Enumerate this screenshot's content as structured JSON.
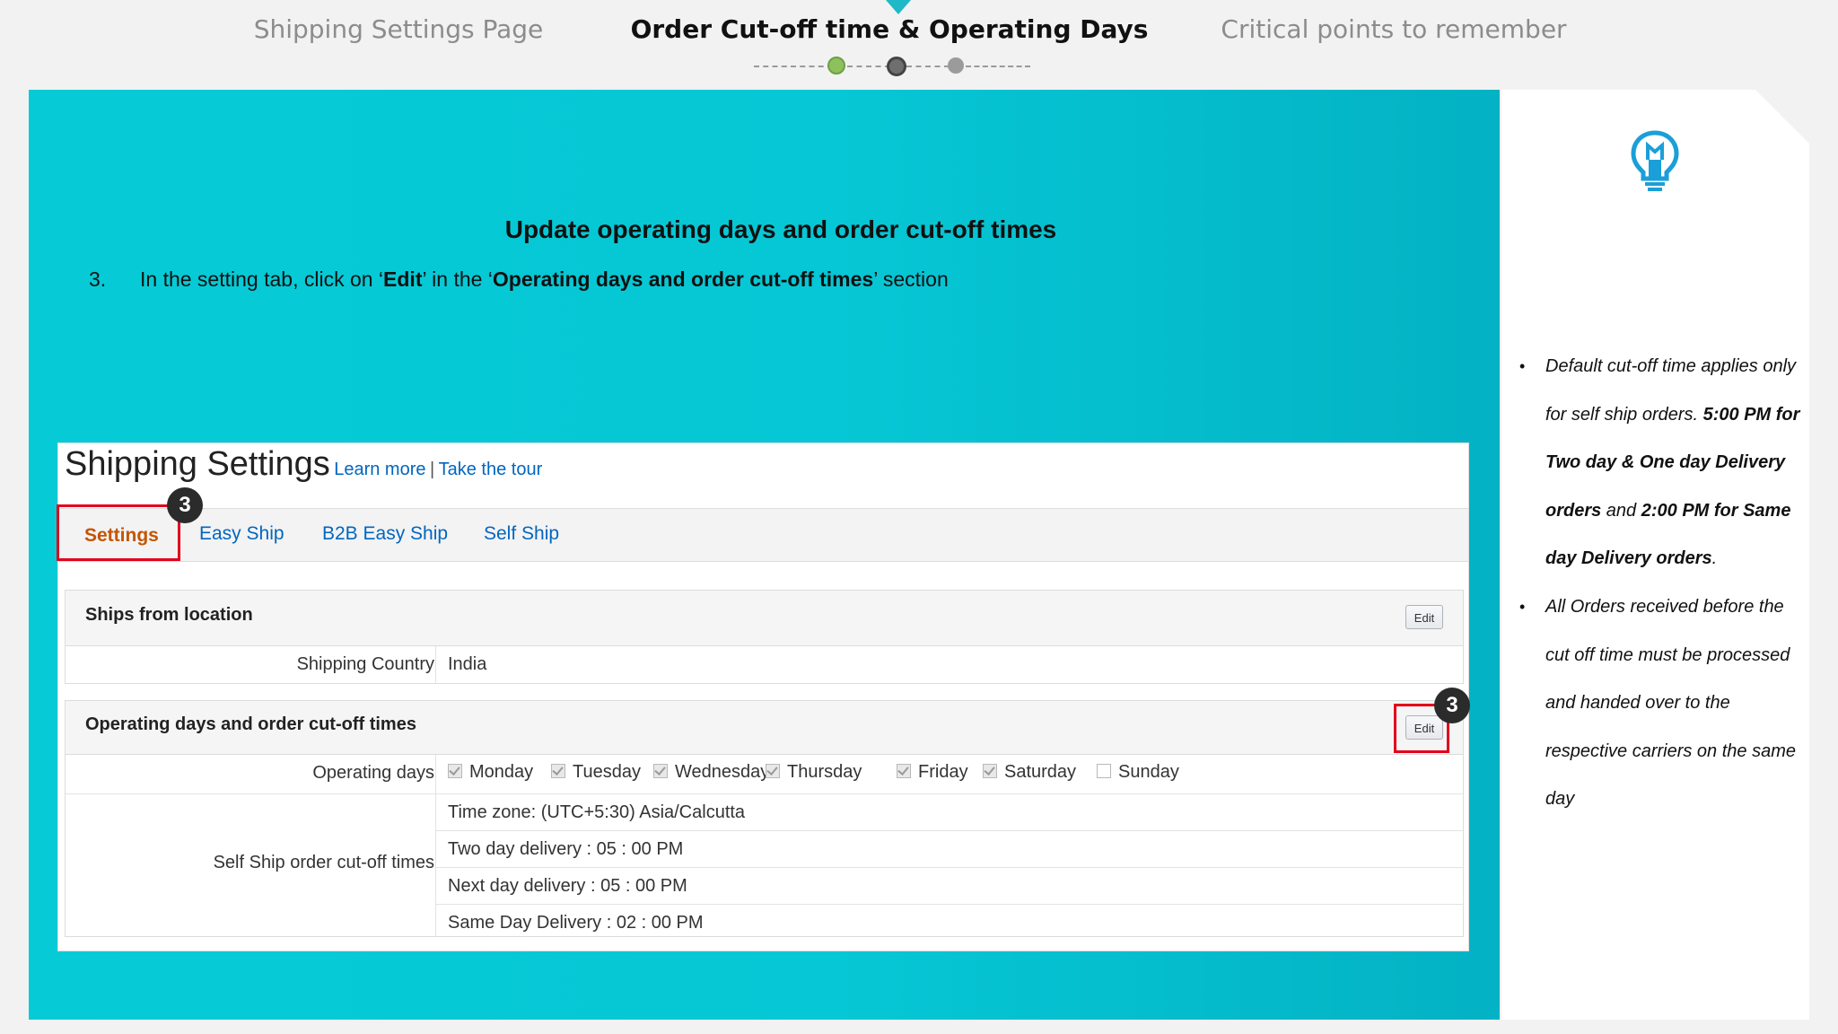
{
  "nav": {
    "steps": [
      "Shipping Settings Page",
      "Order Cut-off time & Operating Days",
      "Critical points to remember"
    ],
    "active_index": 1
  },
  "slide": {
    "title": "Update operating days and order cut-off times",
    "step_number": "3.",
    "instruction": {
      "part1": "In the setting tab, click on ‘",
      "edit": "Edit",
      "part2": "’ in the ‘",
      "section": "Operating days and order cut-off times",
      "part3": "’ section"
    }
  },
  "screenshot": {
    "title": "Shipping Settings",
    "learn_more": "Learn more",
    "separator": "|",
    "take_tour": "Take the tour",
    "tabs": [
      "Settings",
      "Easy Ship",
      "B2B Easy Ship",
      "Self Ship"
    ],
    "callout": "3",
    "ships_from": {
      "title": "Ships from location",
      "edit_label": "Edit",
      "country_label": "Shipping Country",
      "country_value": "India"
    },
    "operating": {
      "title": "Operating days and order cut-off times",
      "edit_label": "Edit",
      "days_label": "Operating days",
      "days": [
        {
          "name": "Monday",
          "checked": true
        },
        {
          "name": "Tuesday",
          "checked": true
        },
        {
          "name": "Wednesday",
          "checked": true
        },
        {
          "name": "Thursday",
          "checked": true
        },
        {
          "name": "Friday",
          "checked": true
        },
        {
          "name": "Saturday",
          "checked": true
        },
        {
          "name": "Sunday",
          "checked": false
        }
      ],
      "cutoff_label": "Self Ship order cut-off times",
      "cutoff_rows": [
        "Time zone: (UTC+5:30) Asia/Calcutta",
        "Two day delivery : 05 : 00 PM",
        "Next day delivery : 05 : 00 PM",
        "Same Day Delivery : 02 : 00 PM"
      ]
    }
  },
  "sidebar": {
    "icon": "lightbulb-icon",
    "notes": [
      {
        "t1": "Default cut-off time applies only for self ship orders. ",
        "b1": "5:00 PM for Two day & One day Delivery orders",
        "t2": " and ",
        "b2": "2:00 PM for Same day Delivery orders",
        "t3": "."
      },
      {
        "t1": "All Orders received before the cut off time must be processed and handed over to the respective carriers on the same day"
      }
    ]
  },
  "colors": {
    "teal": "#06cbd6",
    "active_dot": "#8dc15d",
    "link": "#0066c0",
    "selected_tab": "#c45500",
    "highlight_box": "#e3001b",
    "accent_icon": "#1a9fd9"
  }
}
